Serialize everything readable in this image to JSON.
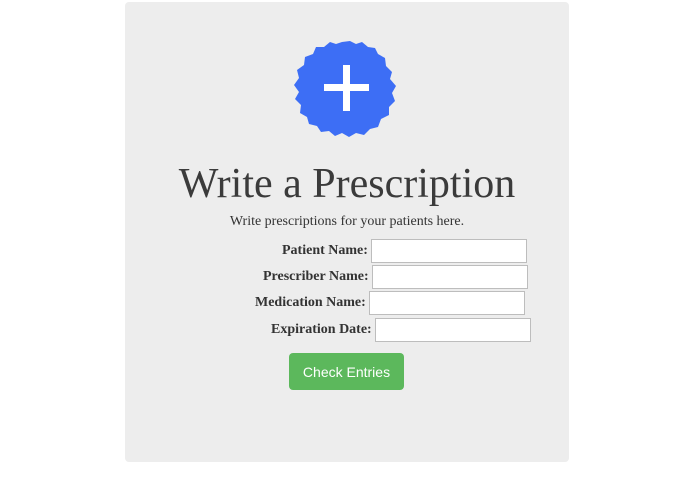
{
  "logo": {
    "icon": "plus-icon",
    "color": "#3d6ef5"
  },
  "header": {
    "title": "Write a Prescription",
    "subtitle": "Write prescriptions for your patients here."
  },
  "form": {
    "fields": [
      {
        "label": "Patient Name:",
        "value": ""
      },
      {
        "label": "Prescriber Name:",
        "value": ""
      },
      {
        "label": "Medication Name:",
        "value": ""
      },
      {
        "label": "Expiration Date:",
        "value": ""
      }
    ],
    "submit_label": "Check Entries",
    "submit_color": "#5cb85c"
  }
}
